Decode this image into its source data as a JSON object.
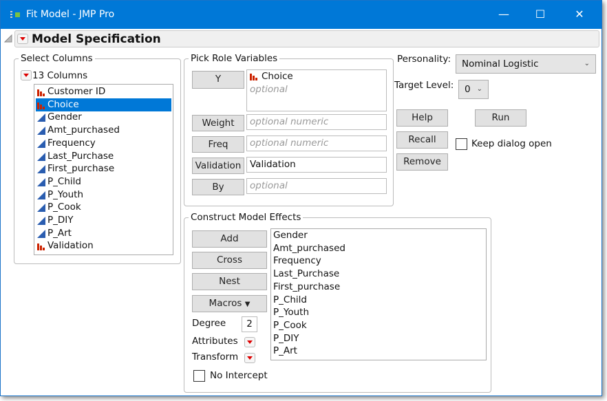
{
  "window": {
    "title": "Fit Model - JMP Pro",
    "minimize": "—",
    "maximize": "☐",
    "close": "✕"
  },
  "header": {
    "title": "Model Specification"
  },
  "select_columns": {
    "label": "Select Columns",
    "count_label": "13 Columns",
    "columns": [
      {
        "name": "Customer ID",
        "type": "nominal"
      },
      {
        "name": "Choice",
        "type": "nominal",
        "selected": true
      },
      {
        "name": "Gender",
        "type": "continuous"
      },
      {
        "name": "Amt_purchased",
        "type": "continuous"
      },
      {
        "name": "Frequency",
        "type": "continuous"
      },
      {
        "name": "Last_Purchase",
        "type": "continuous"
      },
      {
        "name": "First_purchase",
        "type": "continuous"
      },
      {
        "name": "P_Child",
        "type": "continuous"
      },
      {
        "name": "P_Youth",
        "type": "continuous"
      },
      {
        "name": "P_Cook",
        "type": "continuous"
      },
      {
        "name": "P_DIY",
        "type": "continuous"
      },
      {
        "name": "P_Art",
        "type": "continuous"
      },
      {
        "name": "Validation",
        "type": "nominal"
      }
    ]
  },
  "roles": {
    "label": "Pick Role Variables",
    "y": {
      "button": "Y",
      "value": "Choice",
      "placeholder": "optional"
    },
    "weight": {
      "button": "Weight",
      "placeholder": "optional numeric"
    },
    "freq": {
      "button": "Freq",
      "placeholder": "optional numeric"
    },
    "validation": {
      "button": "Validation",
      "value": "Validation"
    },
    "by": {
      "button": "By",
      "placeholder": "optional"
    }
  },
  "options": {
    "personality_label": "Personality:",
    "personality": "Nominal Logistic",
    "target_label": "Target Level:",
    "target": "0",
    "help": "Help",
    "run": "Run",
    "recall": "Recall",
    "remove": "Remove",
    "keep_open": "Keep dialog open",
    "keep_open_checked": false
  },
  "effects": {
    "label": "Construct Model Effects",
    "add": "Add",
    "cross": "Cross",
    "nest": "Nest",
    "macros": "Macros",
    "degree_label": "Degree",
    "degree": "2",
    "attributes": "Attributes",
    "transform": "Transform",
    "no_intercept": "No Intercept",
    "no_intercept_checked": false,
    "items": [
      "Gender",
      "Amt_purchased",
      "Frequency",
      "Last_Purchase",
      "First_purchase",
      "P_Child",
      "P_Youth",
      "P_Cook",
      "P_DIY",
      "P_Art"
    ]
  },
  "colors": {
    "titlebar": "#0078d7",
    "selection": "#0078d7",
    "nominal_icon": "#cc2200",
    "continuous_icon": "#2a5db0"
  }
}
